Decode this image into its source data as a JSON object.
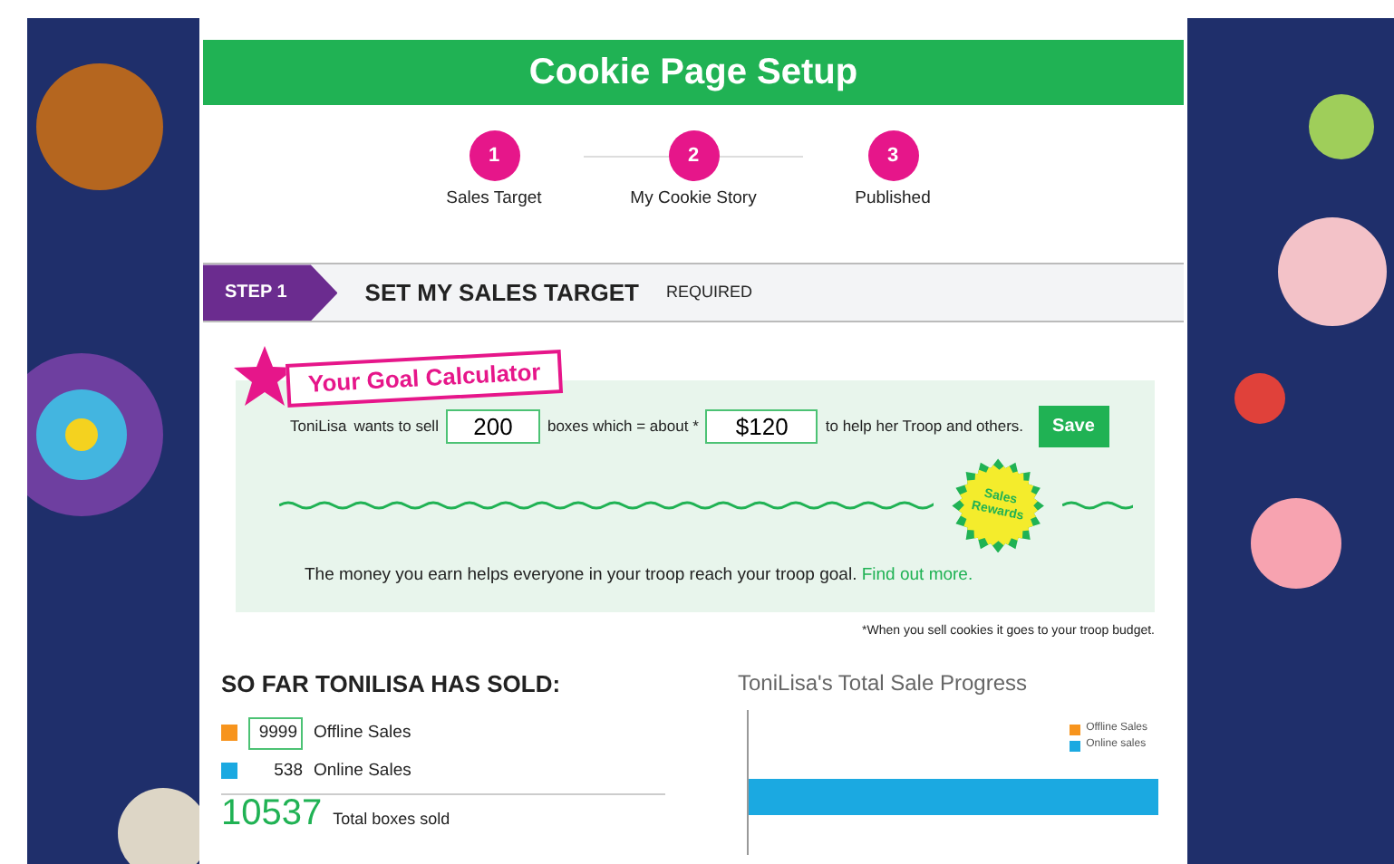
{
  "header": {
    "title": "Cookie Page Setup"
  },
  "steps": [
    {
      "number": "1",
      "label": "Sales Target"
    },
    {
      "number": "2",
      "label": "My Cookie Story"
    },
    {
      "number": "3",
      "label": "Published"
    }
  ],
  "section": {
    "step": "STEP 1",
    "title": "SET MY SALES TARGET",
    "note": "REQUIRED"
  },
  "calculator": {
    "title": "Your Goal Calculator",
    "name": "ToniLisa",
    "text_1": "wants to sell",
    "boxes": "200",
    "text_2": "boxes which = about *",
    "amount": "$120",
    "text_3": "to help her Troop and others.",
    "save": "Save",
    "badge": "Sales Rewards",
    "message": "The money you earn helps everyone in your troop reach your troop goal.",
    "link": "Find out more."
  },
  "footnote": "*When you sell cookies it goes to your troop budget.",
  "sold": {
    "title": "SO FAR TONILISA HAS SOLD:",
    "items": [
      {
        "kind": "input",
        "value": "9999",
        "label": "Offline Sales",
        "color": "#f7941d"
      },
      {
        "kind": "text",
        "value": "538",
        "label": "Online Sales",
        "color": "#1ba9e1"
      }
    ],
    "total": "10537",
    "total_label": "Total boxes sold"
  },
  "progress": {
    "title": "ToniLisa's Total Sale Progress",
    "legend": [
      {
        "label": "Offline Sales",
        "color": "#f7941d"
      },
      {
        "label": "Online sales",
        "color": "#1ba9e1"
      }
    ]
  }
}
